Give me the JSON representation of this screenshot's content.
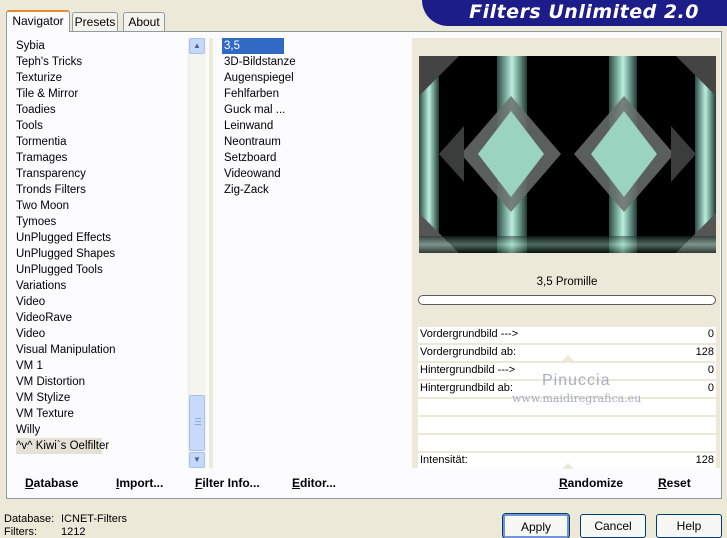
{
  "banner": {
    "title": "Filters Unlimited 2.0"
  },
  "tabs": [
    {
      "label": "Navigator",
      "active": true
    },
    {
      "label": "Presets",
      "active": false
    },
    {
      "label": "About",
      "active": false
    }
  ],
  "categories": {
    "items": [
      "Sybia",
      "Teph's Tricks",
      "Texturize",
      "Tile & Mirror",
      "Toadies",
      "Tools",
      "Tormentia",
      "Tramages",
      "Transparency",
      "Tronds Filters",
      "Two Moon",
      "Tymoes",
      "UnPlugged Effects",
      "UnPlugged Shapes",
      "UnPlugged Tools",
      "Variations",
      "Video",
      "VideoRave",
      "Video",
      "Visual Manipulation",
      "VM 1",
      "VM Distortion",
      "VM Stylize",
      "VM Texture",
      "Willy",
      "^v^ Kiwi`s Oelfilter"
    ],
    "selected": "^v^ Kiwi`s Oelfilter"
  },
  "filters": {
    "items": [
      "3,5 Promille",
      "3D-Bildstanze",
      "Augenspiegel",
      "Fehlfarben",
      "Guck mal ...",
      "Leinwand",
      "Neontraum",
      "Setzboard",
      "Videowand",
      "Zig-Zack"
    ],
    "selected": "3,5 Promille"
  },
  "preview": {
    "filter_name": "3,5 Promille"
  },
  "params": [
    {
      "label": "Vordergrundbild --->",
      "value": "0"
    },
    {
      "label": "Vordergrundbild ab:",
      "value": "128"
    },
    {
      "label": "Hintergrundbild --->",
      "value": "0"
    },
    {
      "label": "Hintergrundbild ab:",
      "value": "0"
    },
    {
      "label": "",
      "value": ""
    },
    {
      "label": "",
      "value": ""
    },
    {
      "label": "",
      "value": ""
    },
    {
      "label": "Intensität:",
      "value": "128"
    }
  ],
  "watermark": {
    "line1": "Pinuccia",
    "line2": "www.maidiregrafica.eu"
  },
  "bottom_buttons": {
    "database": "Database",
    "import": "Import...",
    "filter_info": "Filter Info...",
    "editor": "Editor...",
    "randomize": "Randomize",
    "reset": "Reset"
  },
  "footer": {
    "database_label": "Database:",
    "database_value": "ICNET-Filters",
    "filters_label": "Filters:",
    "filters_value": "1212"
  },
  "dialog_buttons": {
    "apply": "Apply",
    "cancel": "Cancel",
    "help": "Help"
  },
  "colors": {
    "banner_bg": "#1d1d8a",
    "selection": "#316ac5",
    "teal": "#9fd8c4"
  },
  "icons": {
    "scroll_up": "chevron-up-icon",
    "scroll_down": "chevron-down-icon"
  }
}
